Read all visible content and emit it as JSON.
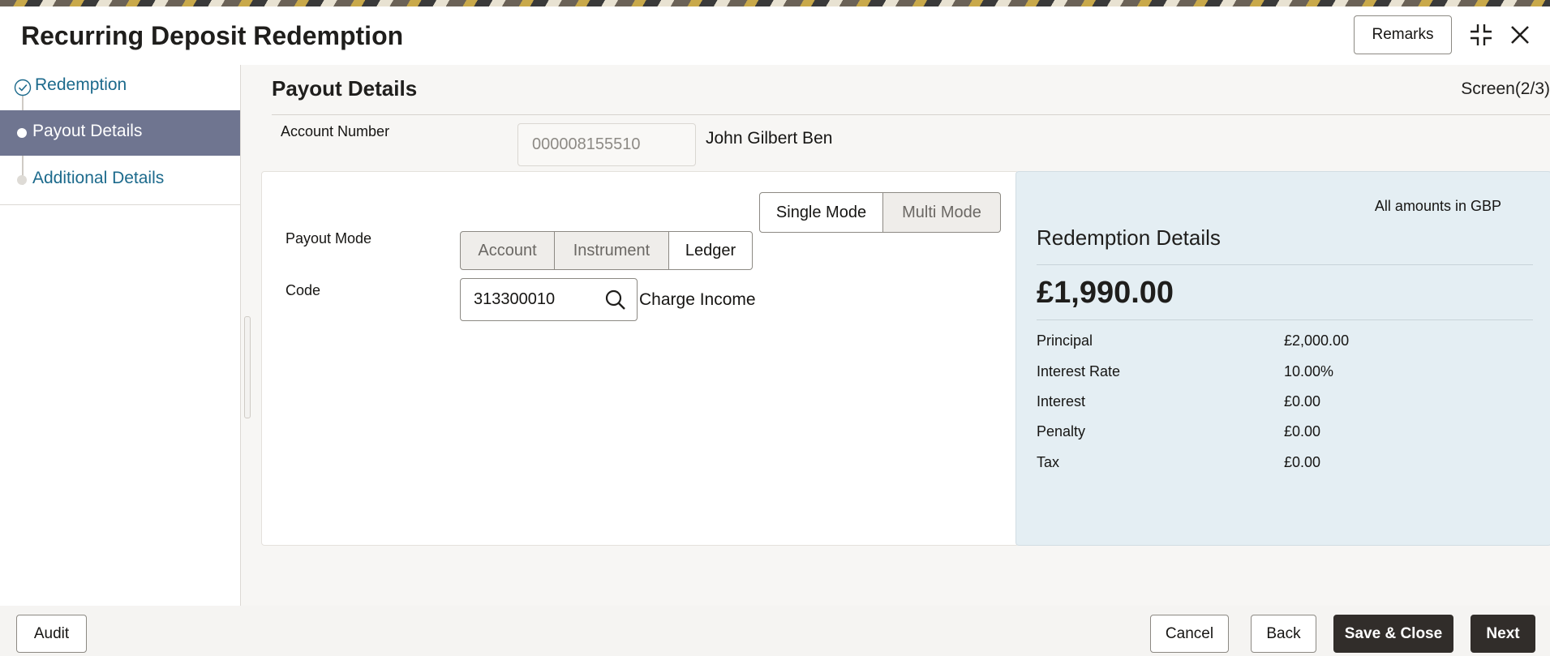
{
  "header": {
    "title": "Recurring Deposit Redemption",
    "remarks_label": "Remarks"
  },
  "sidebar": {
    "items": [
      {
        "label": "Redemption",
        "state": "completed"
      },
      {
        "label": "Payout Details",
        "state": "active"
      },
      {
        "label": "Additional Details",
        "state": "pending"
      }
    ]
  },
  "main": {
    "section_title": "Payout Details",
    "screen_indicator": "Screen(2/3)",
    "account": {
      "label": "Account Number",
      "value": "000008155510",
      "holder_name": "John Gilbert Ben"
    },
    "mode_toggle": {
      "options": [
        "Single Mode",
        "Multi Mode"
      ],
      "selected": "Single Mode"
    },
    "payout_mode": {
      "label": "Payout Mode",
      "options": [
        "Account",
        "Instrument",
        "Ledger"
      ],
      "selected": "Ledger"
    },
    "code": {
      "label": "Code",
      "value": "313300010",
      "description": "Charge Income"
    }
  },
  "summary": {
    "currency_note": "All amounts in GBP",
    "title": "Redemption Details",
    "total": "£1,990.00",
    "rows": [
      {
        "label": "Principal",
        "value": "£2,000.00"
      },
      {
        "label": "Interest Rate",
        "value": "10.00%"
      },
      {
        "label": "Interest",
        "value": "£0.00"
      },
      {
        "label": "Penalty",
        "value": "£0.00"
      },
      {
        "label": "Tax",
        "value": "£0.00"
      }
    ]
  },
  "footer": {
    "audit_label": "Audit",
    "cancel_label": "Cancel",
    "back_label": "Back",
    "save_close_label": "Save & Close",
    "next_label": "Next"
  },
  "colors": {
    "accent_link": "#1c6a8c",
    "active_nav": "#6f7590",
    "primary_button": "#312d2a",
    "summary_background": "#e4eef3"
  },
  "icons": [
    "check-circle-icon",
    "search-icon",
    "minimize-icon",
    "close-icon"
  ]
}
